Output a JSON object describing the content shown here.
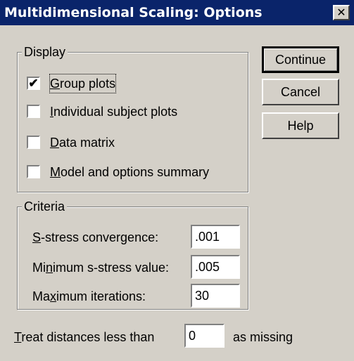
{
  "window": {
    "title": "Multidimensional Scaling: Options",
    "close_glyph": "✕"
  },
  "display": {
    "legend": "Display",
    "items": [
      {
        "key": "G",
        "rest": "roup plots",
        "checked": true
      },
      {
        "key": "I",
        "rest": "ndividual subject plots",
        "checked": false
      },
      {
        "key": "D",
        "rest": "ata matrix",
        "checked": false
      },
      {
        "key": "M",
        "rest": "odel and options summary",
        "checked": false
      }
    ]
  },
  "buttons": {
    "continue": "Continue",
    "cancel": "Cancel",
    "help": "Help"
  },
  "criteria": {
    "legend": "Criteria",
    "s_stress": {
      "key": "S",
      "rest": "-stress convergence:",
      "value": ".001"
    },
    "min_s_stress": {
      "pre": "Mi",
      "key": "n",
      "rest": "imum s-stress value:",
      "value": ".005"
    },
    "max_iter": {
      "pre": "Ma",
      "key": "x",
      "rest": "imum iterations:",
      "value": "30"
    }
  },
  "treat": {
    "key": "T",
    "rest": "reat distances less than",
    "value": "0",
    "suffix": "as missing"
  }
}
